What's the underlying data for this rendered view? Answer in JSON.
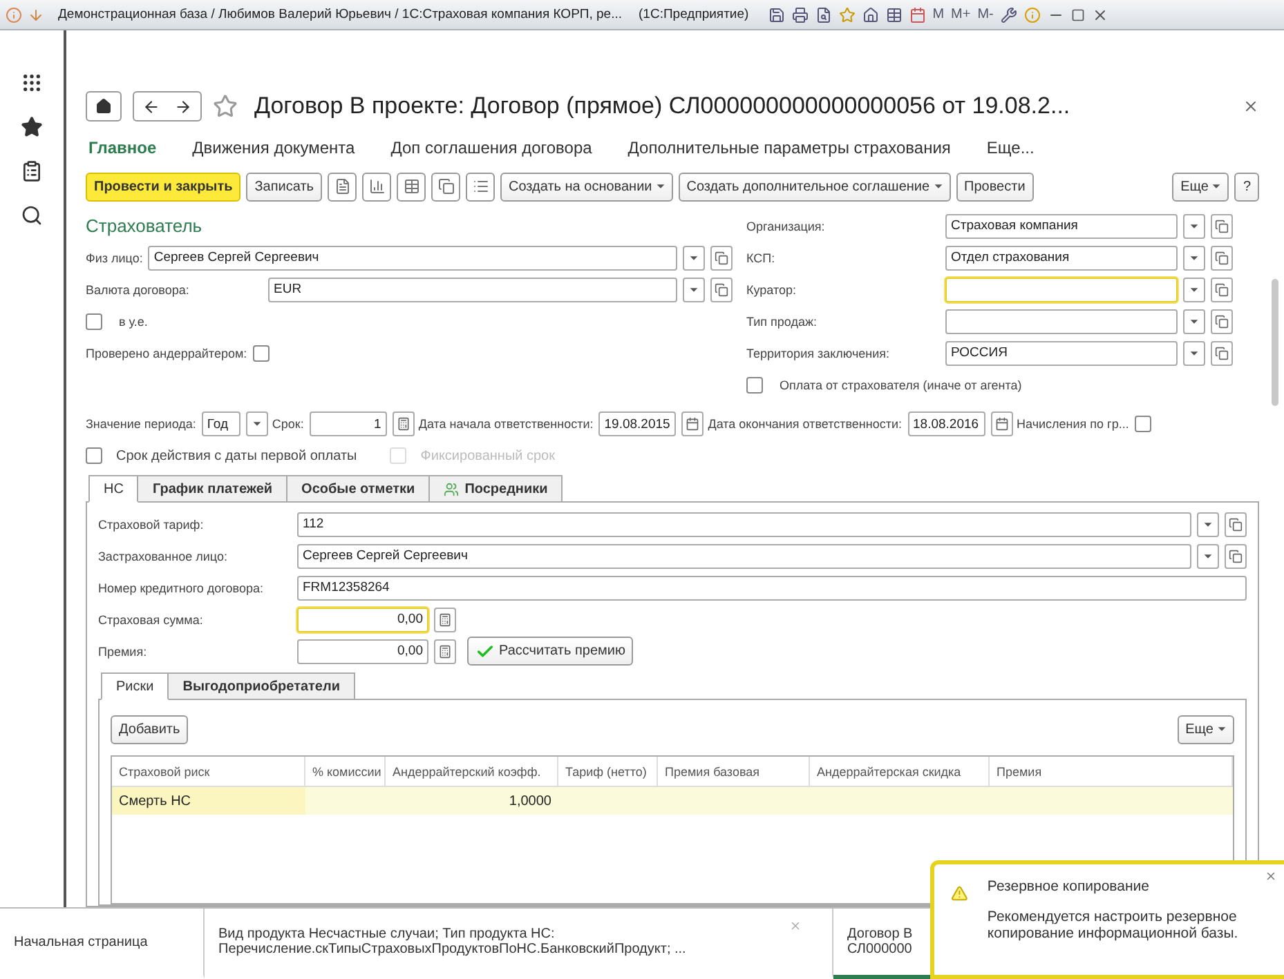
{
  "window": {
    "title": "Демонстрационная база / Любимов Валерий Юрьевич / 1С:Страховая компания КОРП, ре...",
    "app": "(1С:Предприятие)",
    "memory_keys": [
      "M",
      "M+",
      "M-"
    ]
  },
  "document": {
    "title": "Договор В проекте: Договор (прямое) СЛ000000000000000056 от 19.08.2...",
    "nav": [
      {
        "label": "Главное",
        "selected": true
      },
      {
        "label": "Движения документа",
        "selected": false
      },
      {
        "label": "Доп соглашения договора",
        "selected": false
      },
      {
        "label": "Дополнительные параметры страхования",
        "selected": false
      },
      {
        "label": "Еще...",
        "selected": false
      }
    ],
    "commands": [
      {
        "kind": "primary",
        "label": "Провести и закрыть"
      },
      {
        "kind": "button",
        "label": "Записать"
      },
      {
        "kind": "icon"
      },
      {
        "kind": "icon"
      },
      {
        "kind": "icon"
      },
      {
        "kind": "icon"
      },
      {
        "kind": "icon"
      },
      {
        "kind": "menu",
        "label": "Создать на основании"
      },
      {
        "kind": "menu",
        "label": "Создать дополнительное соглашение"
      },
      {
        "kind": "button",
        "label": "Провести"
      }
    ],
    "commands_right": [
      {
        "kind": "menu",
        "label": "Еще"
      },
      {
        "kind": "button",
        "label": "?"
      }
    ],
    "section": "Страхователь",
    "left_fields": [
      {
        "kind": "select",
        "label": "Физ лицо:",
        "value": "Сергеев Сергей Сергеевич"
      },
      {
        "kind": "select",
        "label": "Валюта договора:",
        "value": "EUR"
      },
      {
        "kind": "checkbox",
        "label": "в у.е.",
        "checked": false
      },
      {
        "kind": "check_after",
        "label": "Проверено андеррайтером:",
        "checked": false
      }
    ],
    "right_fields": [
      {
        "kind": "select",
        "label": "Организация:",
        "value": "Страховая компания"
      },
      {
        "kind": "select",
        "label": "КСП:",
        "value": "Отдел страхования"
      },
      {
        "kind": "select",
        "label": "Куратор:",
        "focused": true
      },
      {
        "kind": "select",
        "label": "Тип продаж:",
        "focused": false
      },
      {
        "kind": "select",
        "label": "Территория заключения:",
        "value": "РОССИЯ"
      },
      {
        "kind": "checkbox",
        "label": "Оплата от страхователя (иначе от агента)",
        "checked": false
      }
    ],
    "period": [
      {
        "kind": "select",
        "label": "Значение периода:",
        "value": "Год"
      },
      {
        "kind": "number",
        "label": "Срок:",
        "value": "1"
      },
      {
        "kind": "date",
        "label": "Дата начала ответственности:",
        "value": "19.08.2015"
      },
      {
        "kind": "date",
        "label": "Дата окончания ответственности:",
        "value": "18.08.2016"
      },
      {
        "kind": "check_after",
        "label": "Начисления по гр...",
        "checked": false
      }
    ],
    "options": [
      {
        "label": "Срок действия с даты первой оплаты",
        "checked": false,
        "disabled": false
      },
      {
        "label": "Фиксированный срок",
        "checked": false,
        "disabled": true
      }
    ],
    "tabs": [
      {
        "kind": "plain",
        "label": "НС",
        "selected": true
      },
      {
        "kind": "plain",
        "label": "График платежей",
        "selected": false
      },
      {
        "kind": "plain",
        "label": "Особые отметки",
        "selected": false
      },
      {
        "kind": "with_icon",
        "label": "Посредники",
        "selected": false
      }
    ],
    "tab_fields": [
      {
        "kind": "select",
        "label": "Страховой тариф:",
        "value": "112"
      },
      {
        "kind": "select",
        "label": "Застрахованное лицо:",
        "value": "Сергеев Сергей Сергеевич"
      },
      {
        "kind": "text",
        "label": "Номер кредитного договора:",
        "value": "FRM12358264"
      },
      {
        "kind": "amount",
        "label": "Страховая сумма:",
        "value": "0,00",
        "focused": true
      },
      {
        "kind": "amount",
        "label": "Премия:",
        "value": "0,00",
        "focused": false,
        "action": "Рассчитать премию"
      }
    ],
    "inner_tabs": [
      {
        "label": "Риски",
        "selected": true
      },
      {
        "label": "Выгодоприобретатели",
        "selected": false
      }
    ],
    "table_buttons": {
      "add": "Добавить",
      "more": "Еще"
    },
    "table": {
      "columns": [
        "Страховой риск",
        "% комиссии",
        "Андеррайтерский коэфф.",
        "Тариф (нетто)",
        "Премия базовая",
        "Андеррайтерская скидка",
        "Премия"
      ],
      "rows": [
        {
          "selected": true,
          "risk": "Смерть НС",
          "coefficient": "1,0000"
        }
      ]
    }
  },
  "taskbar": [
    {
      "lines": [
        "Начальная страница"
      ],
      "selected": false,
      "closable": false
    },
    {
      "lines": [
        "Вид продукта Несчастные случаи; Тип продукта НС:",
        "Перечисление.скТипыСтраховыхПродуктовПоНС.БанковскийПродукт; ..."
      ],
      "selected": false,
      "closable": true
    },
    {
      "lines": [
        "Договор В",
        "СЛ000000"
      ],
      "selected": true,
      "closable": false
    }
  ],
  "notification": {
    "title": "Резервное копирование",
    "text": "Рекомендуется настроить резервное копирование информационной базы."
  }
}
